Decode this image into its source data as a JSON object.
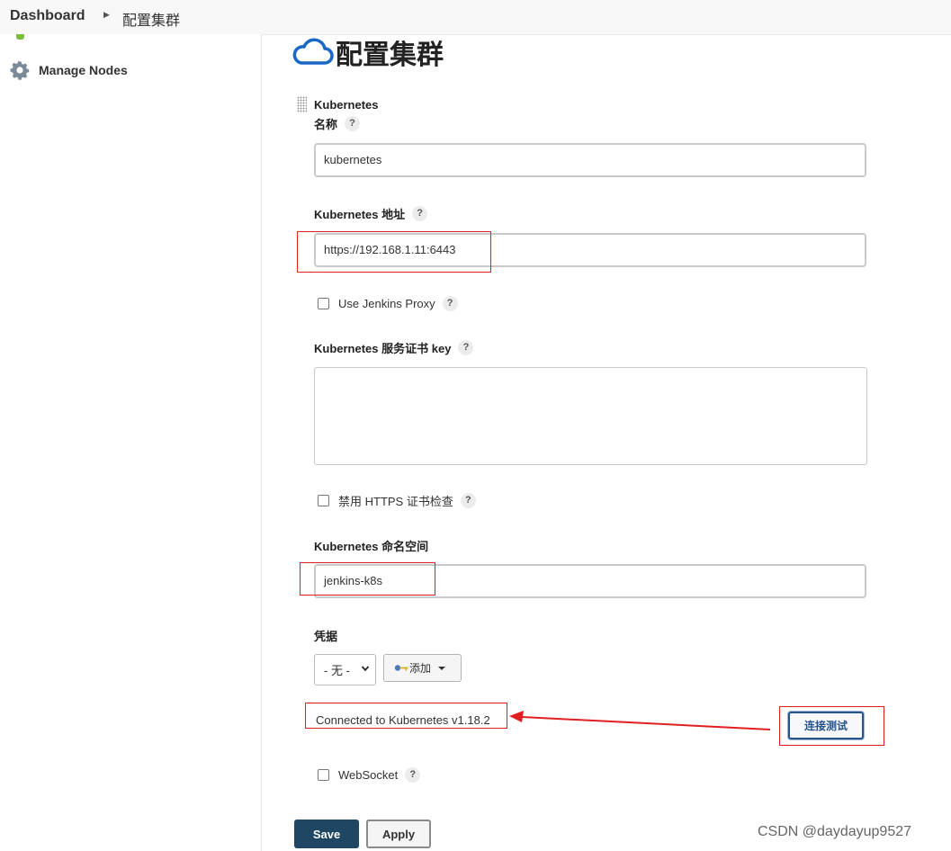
{
  "breadcrumb": {
    "home": "Dashboard",
    "current": "配置集群"
  },
  "sidebar": {
    "items": [
      {
        "label": "Manage Nodes",
        "icon": "gear-icon"
      }
    ]
  },
  "page": {
    "title": "配置集群",
    "icon": "cloud-icon",
    "accent": "#1a67c8"
  },
  "form": {
    "section_title": "Kubernetes",
    "name": {
      "label": "名称",
      "value": "kubernetes"
    },
    "address": {
      "label": "Kubernetes 地址",
      "value": "https://192.168.1.11:6443"
    },
    "use_proxy": {
      "label": "Use Jenkins Proxy",
      "checked": false
    },
    "server_cert_key": {
      "label": "Kubernetes 服务证书 key",
      "value": ""
    },
    "disable_https_check": {
      "label": "禁用 HTTPS 证书检查",
      "checked": false
    },
    "namespace": {
      "label": "Kubernetes 命名空间",
      "value": "jenkins-k8s"
    },
    "credentials": {
      "label": "凭据",
      "selected": "- 无 -",
      "add_label": "添加"
    },
    "connection_status": "Connected to Kubernetes v1.18.2",
    "test_button": "连接测试",
    "websocket": {
      "label": "WebSocket",
      "checked": false
    },
    "help_glyph": "?"
  },
  "buttons": {
    "save": "Save",
    "apply": "Apply"
  },
  "watermark": "CSDN @daydayup9527",
  "colors": {
    "primary_button": "#1f4663",
    "annotation": "#e02020"
  }
}
